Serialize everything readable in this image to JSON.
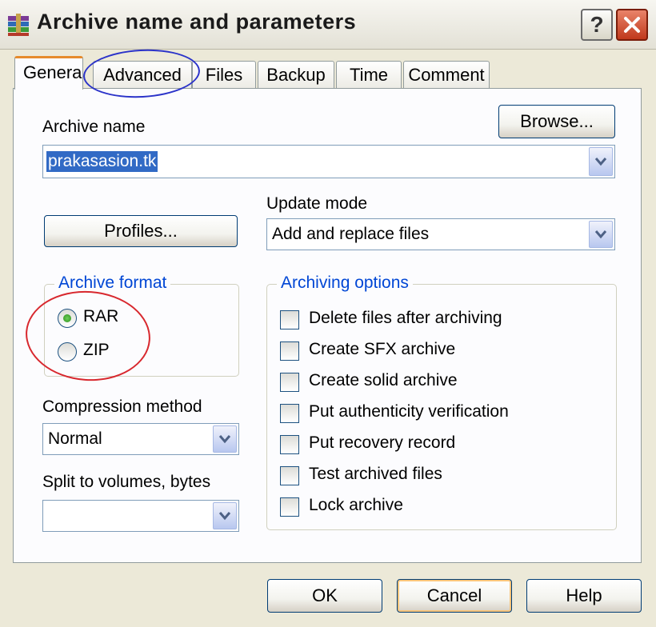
{
  "window": {
    "title": "Archive name and parameters",
    "help_label": "?"
  },
  "tabs": [
    {
      "label": "General"
    },
    {
      "label": "Advanced"
    },
    {
      "label": "Files"
    },
    {
      "label": "Backup"
    },
    {
      "label": "Time"
    },
    {
      "label": "Comment"
    }
  ],
  "general": {
    "archive_name_label": "Archive name",
    "browse_label": "Browse...",
    "archive_name_value": "prakasasion.tk",
    "update_mode_label": "Update mode",
    "update_mode_value": "Add and replace files",
    "profiles_label": "Profiles...",
    "archive_format": {
      "legend": "Archive format",
      "options": [
        {
          "label": "RAR",
          "selected": true
        },
        {
          "label": "ZIP",
          "selected": false
        }
      ]
    },
    "compression_label": "Compression method",
    "compression_value": "Normal",
    "split_label": "Split to volumes, bytes",
    "split_value": "",
    "archiving_options": {
      "legend": "Archiving options",
      "items": [
        {
          "label": "Delete files after archiving",
          "checked": false
        },
        {
          "label": "Create SFX archive",
          "checked": false
        },
        {
          "label": "Create solid archive",
          "checked": false
        },
        {
          "label": "Put authenticity verification",
          "checked": false
        },
        {
          "label": "Put recovery record",
          "checked": false
        },
        {
          "label": "Test archived files",
          "checked": false
        },
        {
          "label": "Lock archive",
          "checked": false
        }
      ]
    }
  },
  "buttons": {
    "ok": "OK",
    "cancel": "Cancel",
    "help": "Help"
  },
  "annotations": {
    "advanced_tab_circle_color": "#2b33c9",
    "archive_format_circle_color": "#d8282e"
  },
  "colors": {
    "dialog_bg": "#ece9d8",
    "panel_bg": "#fcfcfe",
    "group_legend": "#0046d5",
    "active_tab_accent": "#e68b2c"
  }
}
